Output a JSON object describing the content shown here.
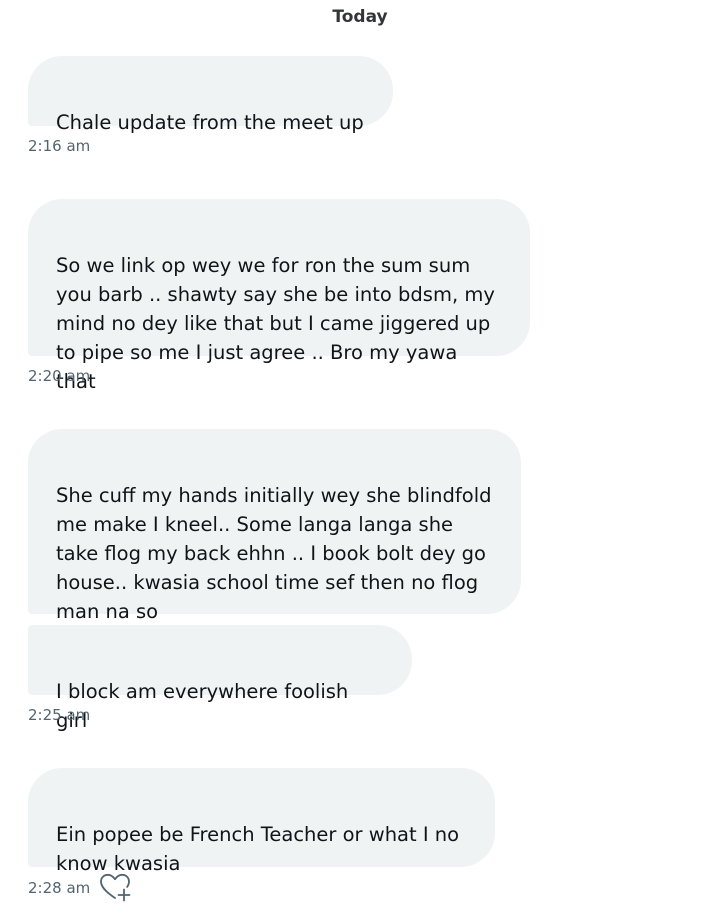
{
  "conversation": {
    "day_label": "Today",
    "messages": [
      {
        "text": "Chale update from the meet up"
      },
      {
        "text": "So we link op wey we for ron the sum sum\nyou barb .. shawty say she be into bdsm, my\nmind no dey like that but I came jiggered up\nto pipe so me I just agree .. Bro my yawa that"
      },
      {
        "text": "She cuff my hands initially wey she blindfold\nme make I kneel.. Some  langa langa she\ntake flog my back ehhn .. I book bolt dey go\nhouse.. kwasia school time sef then no flog\nman na so"
      },
      {
        "text": "I block am everywhere foolish girl"
      },
      {
        "text": "Ein popee be French Teacher or what I no\nknow kwasia"
      }
    ],
    "timestamps": [
      "2:16 am",
      "2:20 am",
      "2:25 am",
      "2:28 am"
    ],
    "reaction_icon": "heart-plus-icon",
    "colors": {
      "bubble_bg": "#eff3f4",
      "text": "#0f1419",
      "timestamp": "#536471"
    }
  }
}
